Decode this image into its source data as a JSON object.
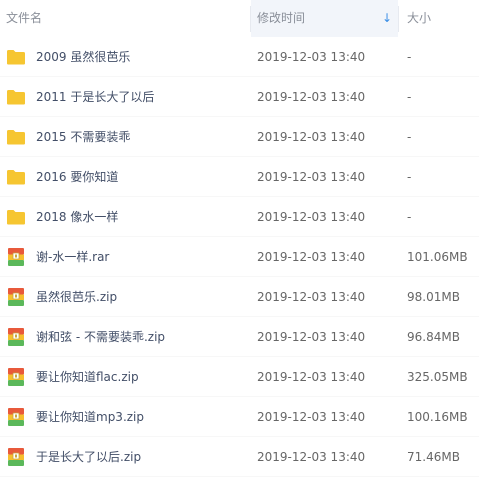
{
  "header": {
    "name_label": "文件名",
    "time_label": "修改时间",
    "size_label": "大小",
    "sort_icon": "↓"
  },
  "colors": {
    "folder": "#f6c531",
    "archive_top": "#e8593b",
    "archive_mid": "#f6bf2d",
    "archive_bottom": "#5bb85a",
    "sort_accent": "#3a8ee6"
  },
  "files": [
    {
      "name": "2009 虽然很芭乐",
      "time": "2019-12-03 13:40",
      "size": "-",
      "icon": "folder-icon"
    },
    {
      "name": "2011 于是长大了以后",
      "time": "2019-12-03 13:40",
      "size": "-",
      "icon": "folder-icon"
    },
    {
      "name": "2015 不需要装乖",
      "time": "2019-12-03 13:40",
      "size": "-",
      "icon": "folder-icon"
    },
    {
      "name": "2016 要你知道",
      "time": "2019-12-03 13:40",
      "size": "-",
      "icon": "folder-icon"
    },
    {
      "name": "2018 像水一样",
      "time": "2019-12-03 13:40",
      "size": "-",
      "icon": "folder-icon"
    },
    {
      "name": "谢-水一样.rar",
      "time": "2019-12-03 13:40",
      "size": "101.06MB",
      "icon": "archive-icon"
    },
    {
      "name": "虽然很芭乐.zip",
      "time": "2019-12-03 13:40",
      "size": "98.01MB",
      "icon": "archive-icon"
    },
    {
      "name": "谢和弦 - 不需要装乖.zip",
      "time": "2019-12-03 13:40",
      "size": "96.84MB",
      "icon": "archive-icon"
    },
    {
      "name": "要让你知道flac.zip",
      "time": "2019-12-03 13:40",
      "size": "325.05MB",
      "icon": "archive-icon"
    },
    {
      "name": "要让你知道mp3.zip",
      "time": "2019-12-03 13:40",
      "size": "100.16MB",
      "icon": "archive-icon"
    },
    {
      "name": "于是长大了以后.zip",
      "time": "2019-12-03 13:40",
      "size": "71.46MB",
      "icon": "archive-icon"
    }
  ]
}
